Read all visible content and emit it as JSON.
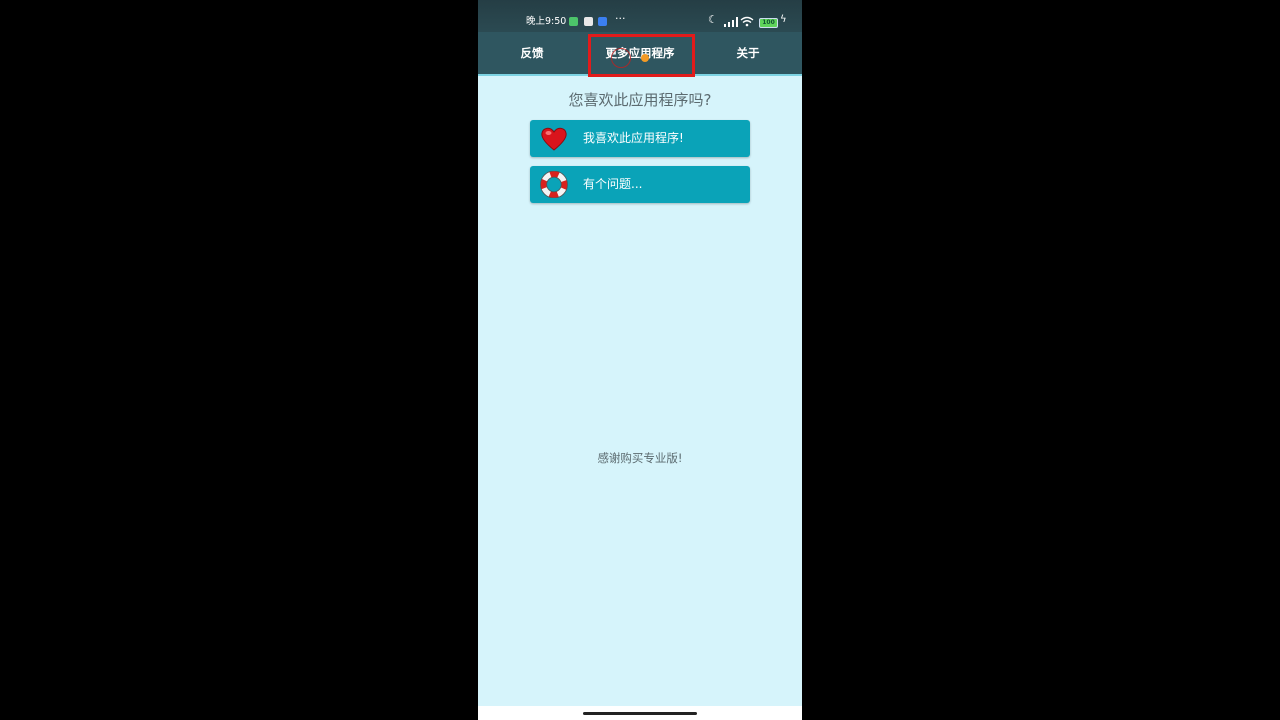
{
  "status_bar": {
    "time": "晚上9:50",
    "more": "···",
    "battery": "100"
  },
  "tabs": {
    "feedback": "反馈",
    "more_apps": "更多应用程序",
    "about": "关于"
  },
  "main": {
    "question": "您喜欢此应用程序吗?",
    "like_button": "我喜欢此应用程序!",
    "problem_button": "有个问题...",
    "thanks": "感谢购买专业版!"
  },
  "colors": {
    "tab_bar": "#2f5660",
    "content_bg": "#d6f4fb",
    "button": "#0aa3b8",
    "highlight": "#e21b1b"
  },
  "icons": {
    "like_button_icon": "heart-icon",
    "problem_button_icon": "lifebuoy-icon"
  }
}
